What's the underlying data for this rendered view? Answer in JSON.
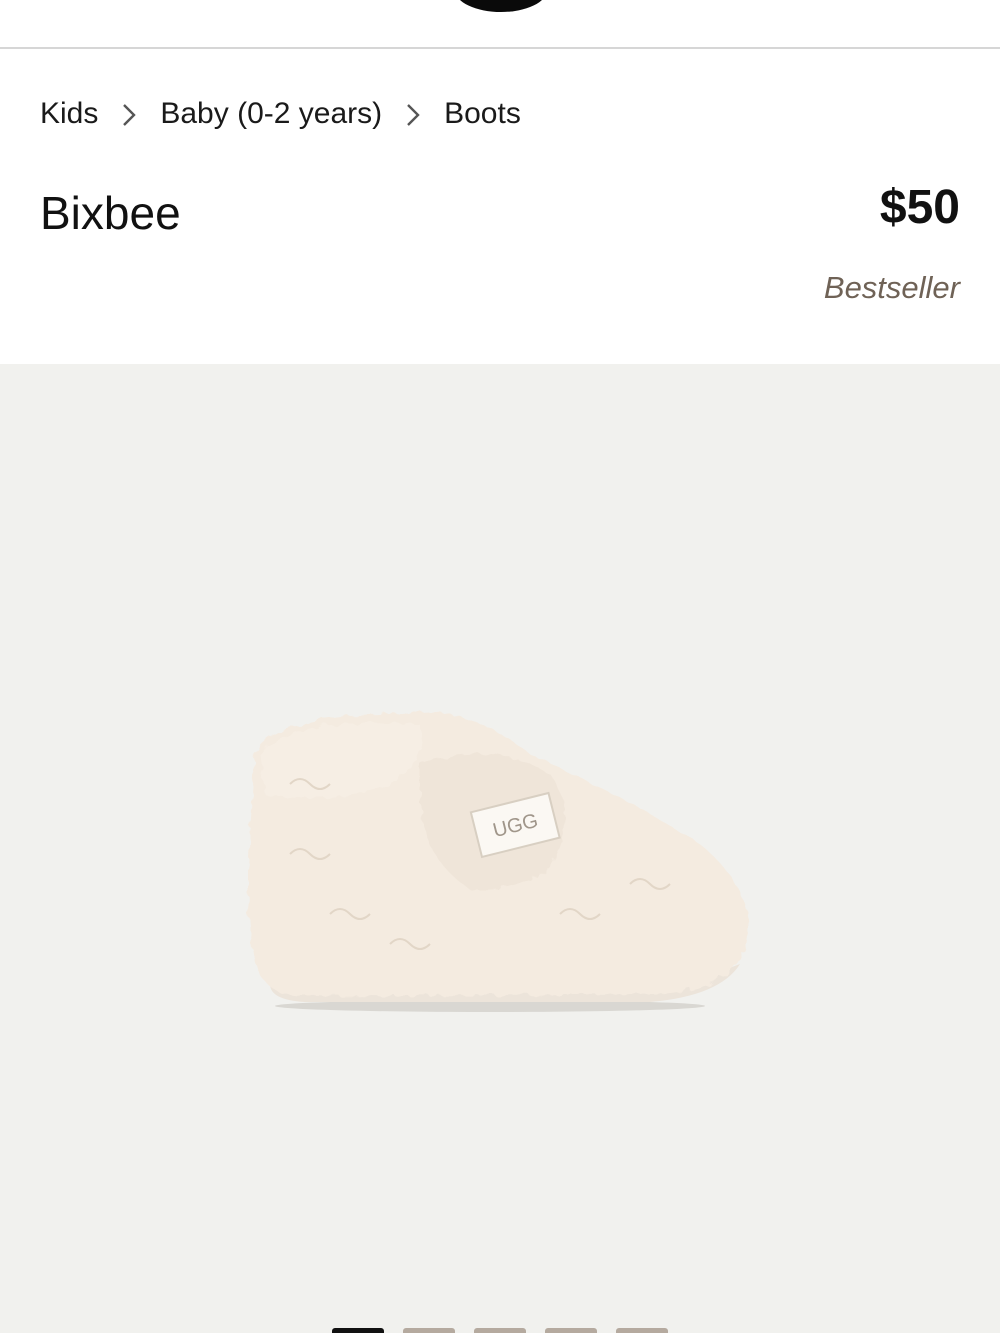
{
  "header": {
    "logo_icon": "brand-logo-icon"
  },
  "breadcrumb": {
    "items": [
      "Kids",
      "Baby (0-2 years)",
      "Boots"
    ],
    "separator_icon": "chevron-right-icon"
  },
  "product": {
    "name": "Bixbee",
    "price": "$50",
    "badge": "Bestseller",
    "image_label": "UGG",
    "image_icon": "product-photo"
  },
  "gallery": {
    "image_count": 5,
    "active_index": 0
  },
  "colors": {
    "background": "#ffffff",
    "gallery_background": "#f1f1ee",
    "badge_text": "#6f6256",
    "dot_active": "#111111",
    "dot_inactive": "#b5aa9f"
  }
}
